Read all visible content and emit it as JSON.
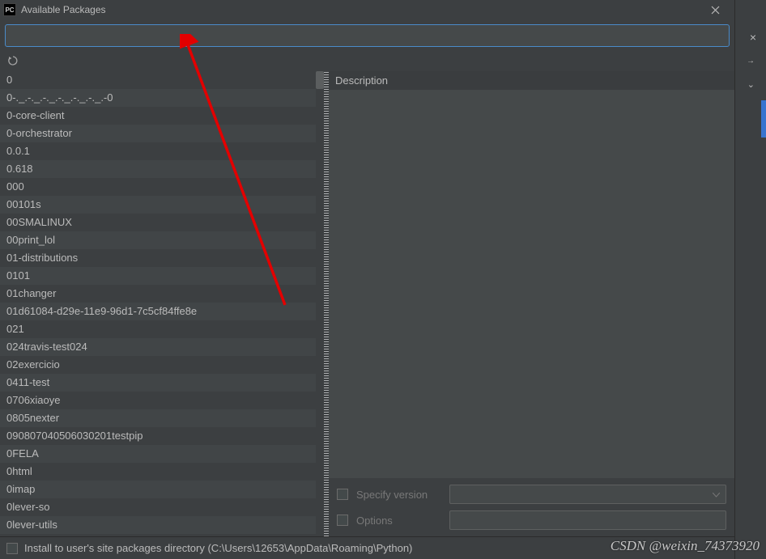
{
  "window": {
    "title": "Available Packages",
    "icon_label": "PC"
  },
  "search": {
    "placeholder": ""
  },
  "packages": [
    "0",
    "0-._.-._.-._.-._.-._.-._.-0",
    "0-core-client",
    "0-orchestrator",
    "0.0.1",
    "0.618",
    "000",
    "00101s",
    "00SMALINUX",
    "00print_lol",
    "01-distributions",
    "0101",
    "01changer",
    "01d61084-d29e-11e9-96d1-7c5cf84ffe8e",
    "021",
    "024travis-test024",
    "02exercicio",
    "0411-test",
    "0706xiaoye",
    "0805nexter",
    "090807040506030201testpip",
    "0FELA",
    "0html",
    "0imap",
    "0lever-so",
    "0lever-utils"
  ],
  "rightPanel": {
    "description_label": "Description",
    "specify_version_label": "Specify version",
    "options_label": "Options"
  },
  "bottomBar": {
    "install_to_user_label": "Install to user's site packages directory (C:\\Users\\12653\\AppData\\Roaming\\Python)"
  },
  "watermark": "CSDN @weixin_74373920"
}
